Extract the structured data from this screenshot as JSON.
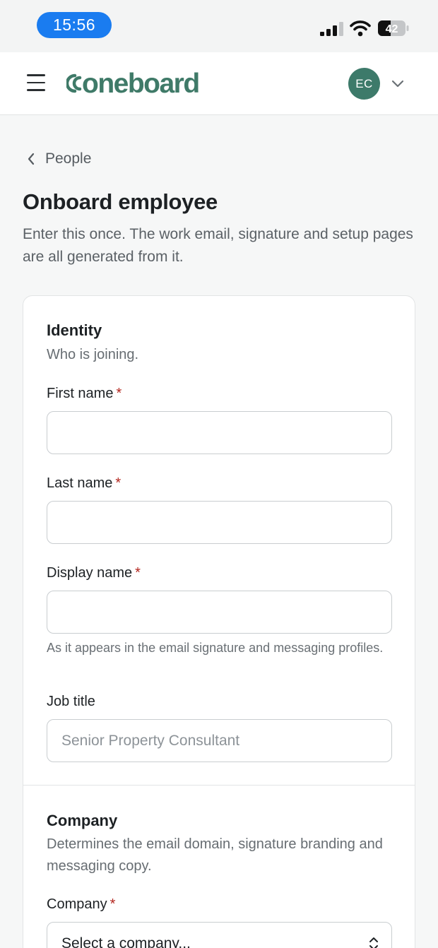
{
  "status_bar": {
    "time": "15:56",
    "battery_level": "42",
    "icons": [
      "cellular-signal-icon",
      "wifi-icon",
      "battery-icon"
    ]
  },
  "header": {
    "logo_text": "oneboard",
    "avatar_initials": "EC",
    "icons": [
      "menu-icon",
      "logo-mark-icon",
      "chevron-down-icon"
    ]
  },
  "page": {
    "back_label": "People",
    "title": "Onboard employee",
    "subtitle": "Enter this once. The work email, signature and setup pages are all generated from it."
  },
  "identity": {
    "title": "Identity",
    "description": "Who is joining.",
    "first_name": {
      "label": "First name",
      "required": "*",
      "value": ""
    },
    "last_name": {
      "label": "Last name",
      "required": "*",
      "value": ""
    },
    "display_name": {
      "label": "Display name",
      "required": "*",
      "value": "",
      "help": "As it appears in the email signature and messaging profiles."
    },
    "job_title": {
      "label": "Job title",
      "value": "",
      "placeholder": "Senior Property Consultant"
    }
  },
  "company": {
    "title": "Company",
    "description": "Determines the email domain, signature branding and messaging copy.",
    "company_field": {
      "label": "Company",
      "required": "*",
      "selected": "Select a company..."
    }
  },
  "colors": {
    "brand": "#3f7a68",
    "avatar": "#3d7a6a",
    "time_pill": "#1a7cf0",
    "required": "#b3261e"
  }
}
